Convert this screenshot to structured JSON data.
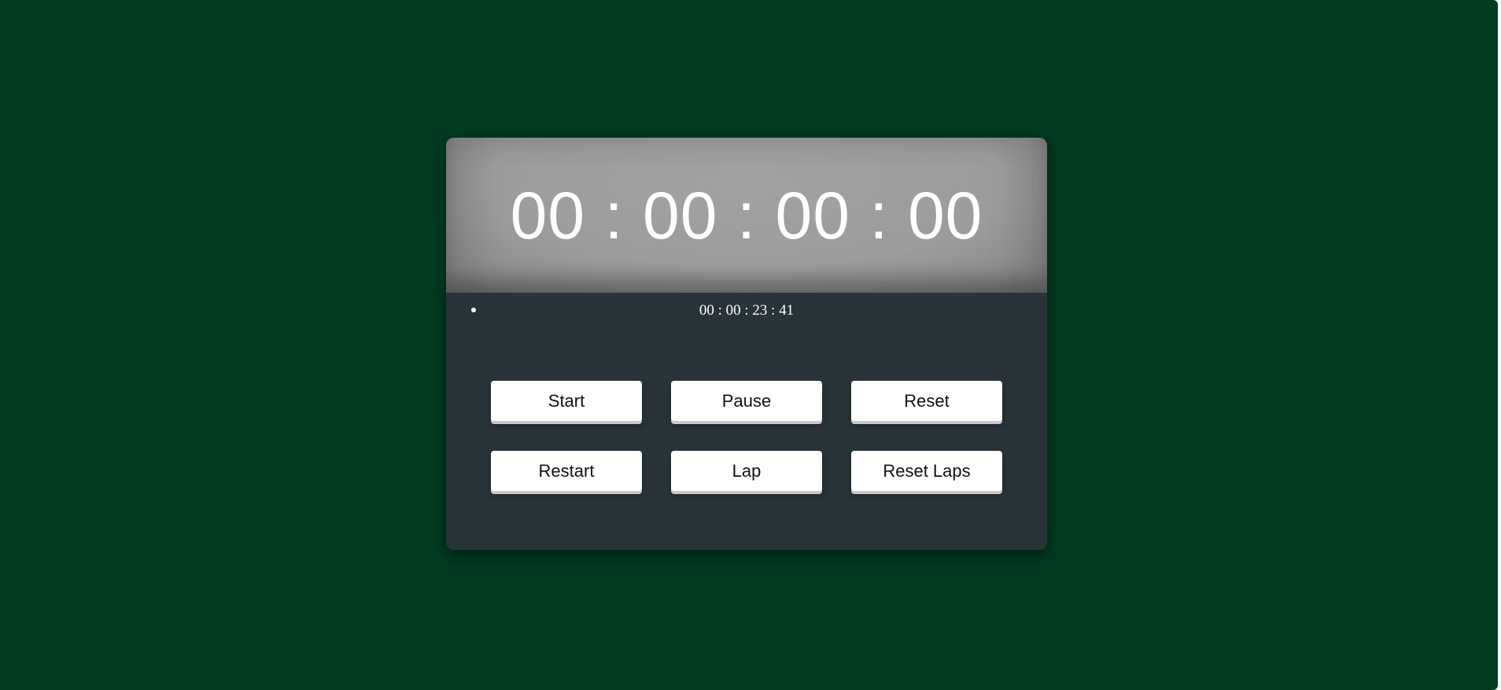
{
  "display": {
    "time": "00 : 00 : 00 : 00"
  },
  "laps": [
    {
      "time": "00 : 00 : 23 : 41"
    }
  ],
  "buttons": {
    "start": "Start",
    "pause": "Pause",
    "reset": "Reset",
    "restart": "Restart",
    "lap": "Lap",
    "reset_laps": "Reset Laps"
  },
  "colors": {
    "page_background": "#003a20",
    "card_background": "#29343a",
    "display_background": "#9c9c9c",
    "button_background": "#ffffff",
    "text_light": "#ffffff",
    "text_dark": "#111111"
  }
}
